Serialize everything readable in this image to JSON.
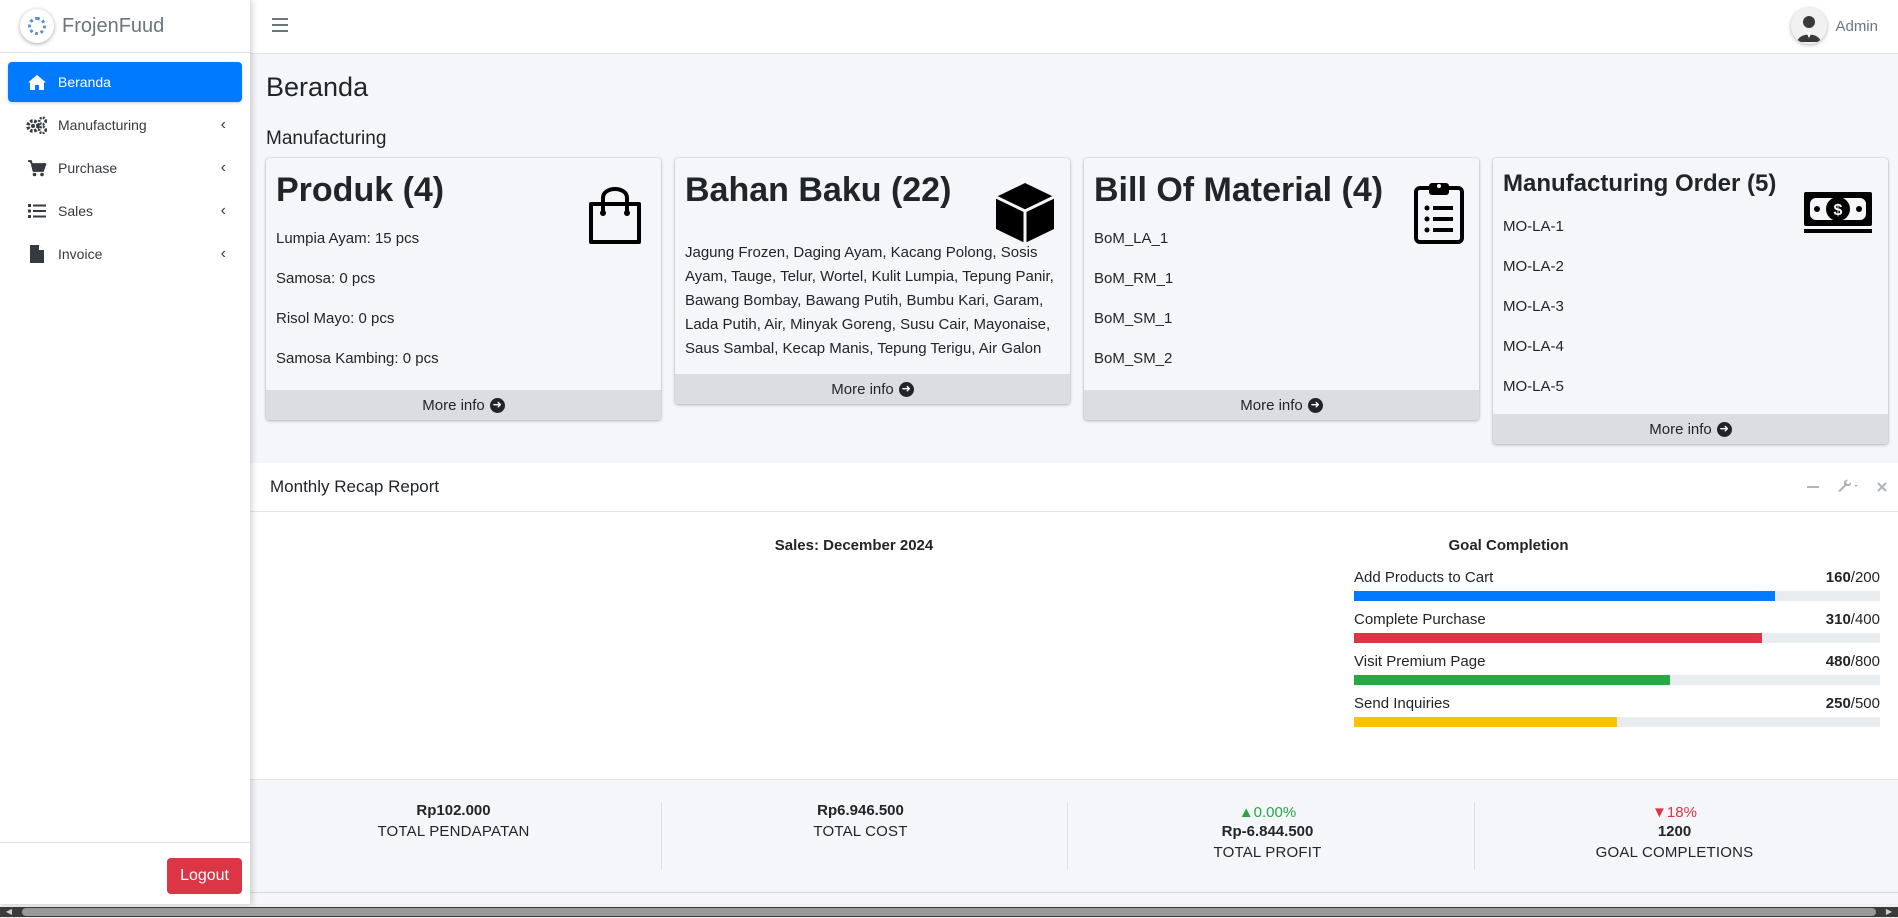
{
  "brand": {
    "name": "FrojenFuud"
  },
  "sidebar": {
    "items": [
      {
        "label": "Beranda",
        "icon": "home-icon",
        "active": true
      },
      {
        "label": "Manufacturing",
        "icon": "gears-icon"
      },
      {
        "label": "Purchase",
        "icon": "cart-icon"
      },
      {
        "label": "Sales",
        "icon": "list-icon"
      },
      {
        "label": "Invoice",
        "icon": "file-icon"
      }
    ],
    "logout_label": "Logout"
  },
  "navbar": {
    "user_name": "Admin"
  },
  "page": {
    "title": "Beranda",
    "section": "Manufacturing"
  },
  "cards": {
    "produk": {
      "title": "Produk (4)",
      "lines": [
        "Lumpia Ayam: 15 pcs",
        "Samosa: 0 pcs",
        "Risol Mayo: 0 pcs",
        "Samosa Kambing: 0 pcs"
      ],
      "more": "More info"
    },
    "bahan": {
      "title": "Bahan Baku (22)",
      "text": "Jagung Frozen, Daging Ayam, Kacang Polong, Sosis Ayam, Tauge, Telur, Wortel, Kulit Lumpia, Tepung Panir, Bawang Bombay, Bawang Putih, Bumbu Kari, Garam, Lada Putih, Air, Minyak Goreng, Susu Cair, Mayonaise, Saus Sambal, Kecap Manis, Tepung Terigu, Air Galon",
      "more": "More info"
    },
    "bom": {
      "title": "Bill Of Material (4)",
      "lines": [
        "BoM_LA_1",
        "BoM_RM_1",
        "BoM_SM_1",
        "BoM_SM_2"
      ],
      "more": "More info"
    },
    "mo": {
      "title": "Manufacturing Order (5)",
      "lines": [
        "MO-LA-1",
        "MO-LA-2",
        "MO-LA-3",
        "MO-LA-4",
        "MO-LA-5"
      ],
      "more": "More info"
    }
  },
  "report": {
    "title": "Monthly Recap Report",
    "chart_title": "Sales: December 2024",
    "goal_title": "Goal Completion",
    "goals": [
      {
        "label": "Add Products to Cart",
        "value": "160",
        "total": "/200",
        "fraction": 0.8,
        "color": "#007bff"
      },
      {
        "label": "Complete Purchase",
        "value": "310",
        "total": "/400",
        "fraction": 0.775,
        "color": "#dc3545"
      },
      {
        "label": "Visit Premium Page",
        "value": "480",
        "total": "/800",
        "fraction": 0.6,
        "color": "#28a745"
      },
      {
        "label": "Send Inquiries",
        "value": "250",
        "total": "/500",
        "fraction": 0.5,
        "color": "#ffc107"
      }
    ],
    "stats": [
      {
        "value": "Rp102.000",
        "label": "TOTAL PENDAPATAN"
      },
      {
        "value": "Rp6.946.500",
        "label": "TOTAL COST"
      },
      {
        "pct": "0.00%",
        "trend": "up",
        "value": "Rp-6.844.500",
        "label": "TOTAL PROFIT"
      },
      {
        "pct": "18%",
        "trend": "down",
        "value": "1200",
        "label": "GOAL COMPLETIONS"
      }
    ]
  }
}
